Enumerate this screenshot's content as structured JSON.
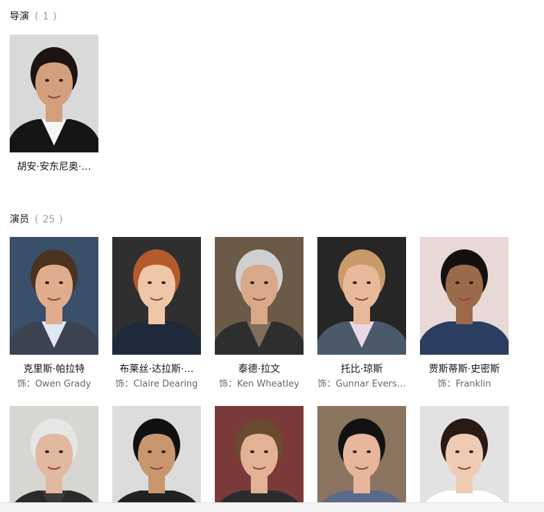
{
  "directors": {
    "title": "导演",
    "count": "1",
    "people": [
      {
        "name": "胡安·安东尼奥·…",
        "role": "",
        "bg": "#d9d9d9",
        "skin": "#d2a07c",
        "hair": "#1b1410",
        "shirt": "#f5f5f5",
        "jacket": "#151515"
      }
    ]
  },
  "actors": {
    "title": "演员",
    "count": "25",
    "people": [
      {
        "name": "克里斯·帕拉特",
        "role": "饰：Owen Grady",
        "bg": "#3a4f6a",
        "skin": "#e0ad8c",
        "hair": "#4a3321",
        "shirt": "#dfe8f2",
        "jacket": "#3b4250"
      },
      {
        "name": "布莱丝·达拉斯·…",
        "role": "饰：Claire Dearing",
        "bg": "#2f2f2f",
        "skin": "#f0c6a8",
        "hair": "#b55a2a",
        "shirt": "#1e2a3a",
        "jacket": "#1e2a3a"
      },
      {
        "name": "泰德·拉文",
        "role": "饰：Ken Wheatley",
        "bg": "#6b5a48",
        "skin": "#d9a88a",
        "hair": "#cfcfcf",
        "shirt": "#7d6f5a",
        "jacket": "#2e2e2e"
      },
      {
        "name": "托比·琼斯",
        "role": "饰：Gunnar Evers…",
        "bg": "#262626",
        "skin": "#e8b89a",
        "hair": "#c99a6a",
        "shirt": "#e9d8e8",
        "jacket": "#4a5a6a"
      },
      {
        "name": "贾斯蒂斯·史密斯",
        "role": "饰：Franklin",
        "bg": "#e8d9d6",
        "skin": "#9a6a4a",
        "hair": "#151010",
        "shirt": "#2b3d60",
        "jacket": "#2b3d60"
      },
      {
        "name": "",
        "role": "",
        "bg": "#d8d6d2",
        "skin": "#e2b8a0",
        "hair": "#e6e6e6",
        "shirt": "#3a3a3a",
        "jacket": "#2a2a2a"
      },
      {
        "name": "",
        "role": "",
        "bg": "#dcdcdc",
        "skin": "#c9966e",
        "hair": "#111111",
        "shirt": "#222222",
        "jacket": "#222222"
      },
      {
        "name": "",
        "role": "",
        "bg": "#7a3a3a",
        "skin": "#e3b294",
        "hair": "#6a4a30",
        "shirt": "#2c2c30",
        "jacket": "#2c2c30"
      },
      {
        "name": "",
        "role": "",
        "bg": "#8a7460",
        "skin": "#e6b79c",
        "hair": "#121212",
        "shirt": "#5a6a8a",
        "jacket": "#5a6a8a"
      },
      {
        "name": "",
        "role": "",
        "bg": "#e2e2e2",
        "skin": "#f0cbb4",
        "hair": "#2a1a14",
        "shirt": "#ffffff",
        "jacket": "#ffffff"
      }
    ]
  }
}
